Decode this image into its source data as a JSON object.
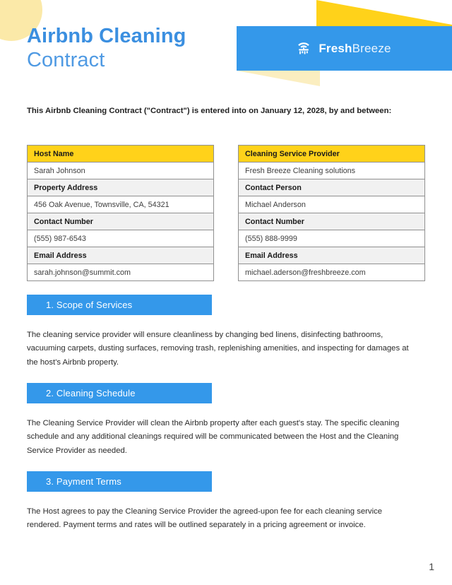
{
  "header": {
    "title_line1": "Airbnb Cleaning",
    "title_line2": "Contract",
    "brand_name_bold": "Fresh",
    "brand_name_light": "Breeze",
    "logo_icon": "cleaning-spray-house-icon"
  },
  "intro": {
    "text": "This Airbnb Cleaning Contract (\"Contract\") is entered into on January 12, 2028, by and between:"
  },
  "party_tables": {
    "host": {
      "header": "Host Name",
      "rows": [
        {
          "label": "Sarah Johnson",
          "type": "value"
        },
        {
          "label": "Property Address",
          "type": "label"
        },
        {
          "label": "456 Oak Avenue, Townsville, CA, 54321",
          "type": "value"
        },
        {
          "label": "Contact Number",
          "type": "label"
        },
        {
          "label": "(555) 987-6543",
          "type": "value"
        },
        {
          "label": "Email Address",
          "type": "label"
        },
        {
          "label": "sarah.johnson@summit.com",
          "type": "value"
        }
      ]
    },
    "provider": {
      "header": "Cleaning Service Provider",
      "rows": [
        {
          "label": "Fresh Breeze Cleaning solutions",
          "type": "value"
        },
        {
          "label": "Contact Person",
          "type": "label"
        },
        {
          "label": "Michael Anderson",
          "type": "value"
        },
        {
          "label": "Contact Number",
          "type": "label"
        },
        {
          "label": "(555) 888-9999",
          "type": "value"
        },
        {
          "label": "Email Address",
          "type": "label"
        },
        {
          "label": "michael.aderson@freshbreeze.com",
          "type": "value"
        }
      ]
    }
  },
  "sections": [
    {
      "heading": "1. Scope of Services",
      "body": "The cleaning service provider will ensure cleanliness by changing bed linens, disinfecting bathrooms, vacuuming carpets, dusting surfaces, removing trash, replenishing amenities, and inspecting for damages at the host's Airbnb property."
    },
    {
      "heading": "2. Cleaning Schedule",
      "body": "The Cleaning Service Provider will clean the Airbnb property after each guest's stay. The specific cleaning schedule and any additional cleanings required will be communicated between the Host and the Cleaning Service Provider as needed."
    },
    {
      "heading": "3. Payment Terms",
      "body": "The Host agrees to pay the Cleaning Service Provider the agreed-upon fee for each cleaning service rendered. Payment terms and rates will be outlined separately in a pricing agreement or invoice."
    }
  ],
  "footer": {
    "page_number": "1"
  },
  "colors": {
    "brand_blue": "#3498ea",
    "title_blue": "#3b8fe0",
    "accent_yellow": "#ffd21a",
    "pale_yellow": "#fbe9a8",
    "label_gray": "#f1f1f1",
    "border_gray": "#909090"
  }
}
